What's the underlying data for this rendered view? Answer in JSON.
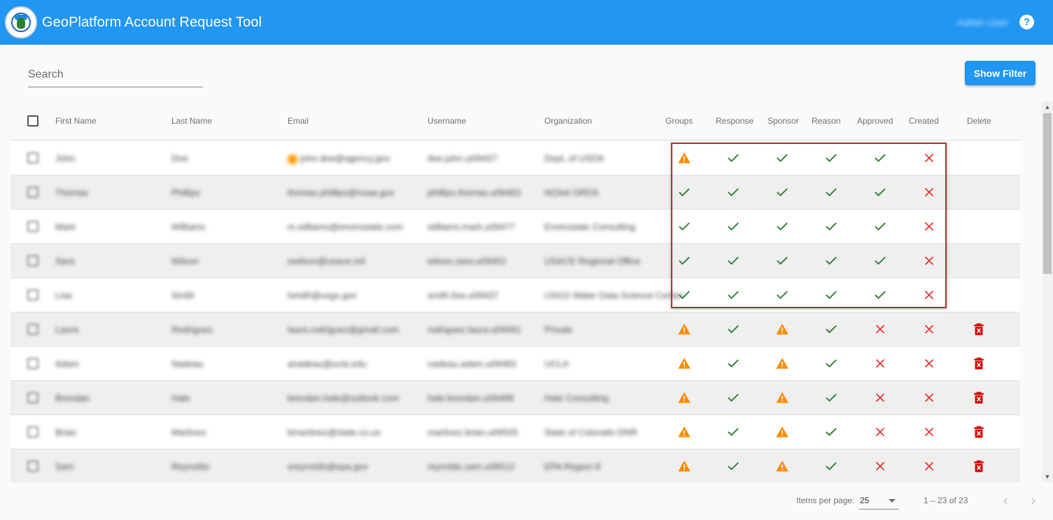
{
  "app": {
    "title": "GeoPlatform Account Request Tool",
    "user_name": "Admin User",
    "accent": "#2196f3"
  },
  "search": {
    "placeholder": "Search",
    "value": ""
  },
  "actions": {
    "show_filter_label": "Show Filter"
  },
  "table": {
    "columns": [
      "First Name",
      "Last Name",
      "Email",
      "Username",
      "Organization",
      "Groups",
      "Response",
      "Sponsor",
      "Reason",
      "Approved",
      "Created",
      "Delete"
    ],
    "rows": [
      {
        "first": "John",
        "last": "Doe",
        "email": "john.doe@agency.gov",
        "email_flag": true,
        "username": "doe.john.ui09427",
        "org": "Dept. of USDA",
        "status": [
          "warn",
          "ok",
          "ok",
          "ok",
          "ok",
          "no"
        ],
        "delete": false
      },
      {
        "first": "Thomas",
        "last": "Phillips",
        "email": "thomas.phillips@noaa.gov",
        "email_flag": false,
        "username": "phillips.thomas.u09463",
        "org": "NOAA ORDS",
        "status": [
          "ok",
          "ok",
          "ok",
          "ok",
          "ok",
          "no"
        ],
        "delete": false
      },
      {
        "first": "Mark",
        "last": "Williams",
        "email": "m.williams@envirostate.com",
        "email_flag": false,
        "username": "williams.mark.u09477",
        "org": "Envirostate Consulting",
        "status": [
          "ok",
          "ok",
          "ok",
          "ok",
          "ok",
          "no"
        ],
        "delete": false
      },
      {
        "first": "Sara",
        "last": "Wilson",
        "email": "swilson@usace.mil",
        "email_flag": false,
        "username": "wilson.sara.u09452",
        "org": "USACE Regional Office",
        "status": [
          "ok",
          "ok",
          "ok",
          "ok",
          "ok",
          "no"
        ],
        "delete": false
      },
      {
        "first": "Lisa",
        "last": "Smith",
        "email": "lsmith@usgs.gov",
        "email_flag": false,
        "username": "smith.lisa.u09437",
        "org": "USGS Water Data Science Center",
        "status": [
          "ok",
          "ok",
          "ok",
          "ok",
          "ok",
          "no"
        ],
        "delete": false
      },
      {
        "first": "Laura",
        "last": "Rodriguez",
        "email": "laura.rodriguez@gmail.com",
        "email_flag": false,
        "username": "rodriguez.laura.u09491",
        "org": "Private",
        "status": [
          "warn",
          "ok",
          "warn",
          "ok",
          "no",
          "no"
        ],
        "delete": true
      },
      {
        "first": "Adam",
        "last": "Nadeau",
        "email": "anadeau@ucla.edu",
        "email_flag": false,
        "username": "nadeau.adam.u09483",
        "org": "UCLA",
        "status": [
          "warn",
          "ok",
          "warn",
          "ok",
          "no",
          "no"
        ],
        "delete": true
      },
      {
        "first": "Brendan",
        "last": "Hale",
        "email": "brendan.hale@outlook.com",
        "email_flag": false,
        "username": "hale.brendan.u09498",
        "org": "Hale Consulting",
        "status": [
          "warn",
          "ok",
          "warn",
          "ok",
          "no",
          "no"
        ],
        "delete": true
      },
      {
        "first": "Brian",
        "last": "Martinez",
        "email": "bmartinez@state.co.us",
        "email_flag": false,
        "username": "martinez.brian.u09505",
        "org": "State of Colorado DNR",
        "status": [
          "warn",
          "ok",
          "warn",
          "ok",
          "no",
          "no"
        ],
        "delete": true
      },
      {
        "first": "Sam",
        "last": "Reynolds",
        "email": "sreynolds@epa.gov",
        "email_flag": false,
        "username": "reynolds.sam.u09512",
        "org": "EPA Region 8",
        "status": [
          "warn",
          "ok",
          "warn",
          "ok",
          "no",
          "no"
        ],
        "delete": true
      }
    ]
  },
  "paginator": {
    "items_per_page_label": "Items per page:",
    "items_per_page_value": "25",
    "range_label": "1 – 23 of 23"
  },
  "colors": {
    "ok": "#2e7d32",
    "no": "#e53935",
    "warn": "#fb8c00",
    "delete": "#d50000"
  }
}
